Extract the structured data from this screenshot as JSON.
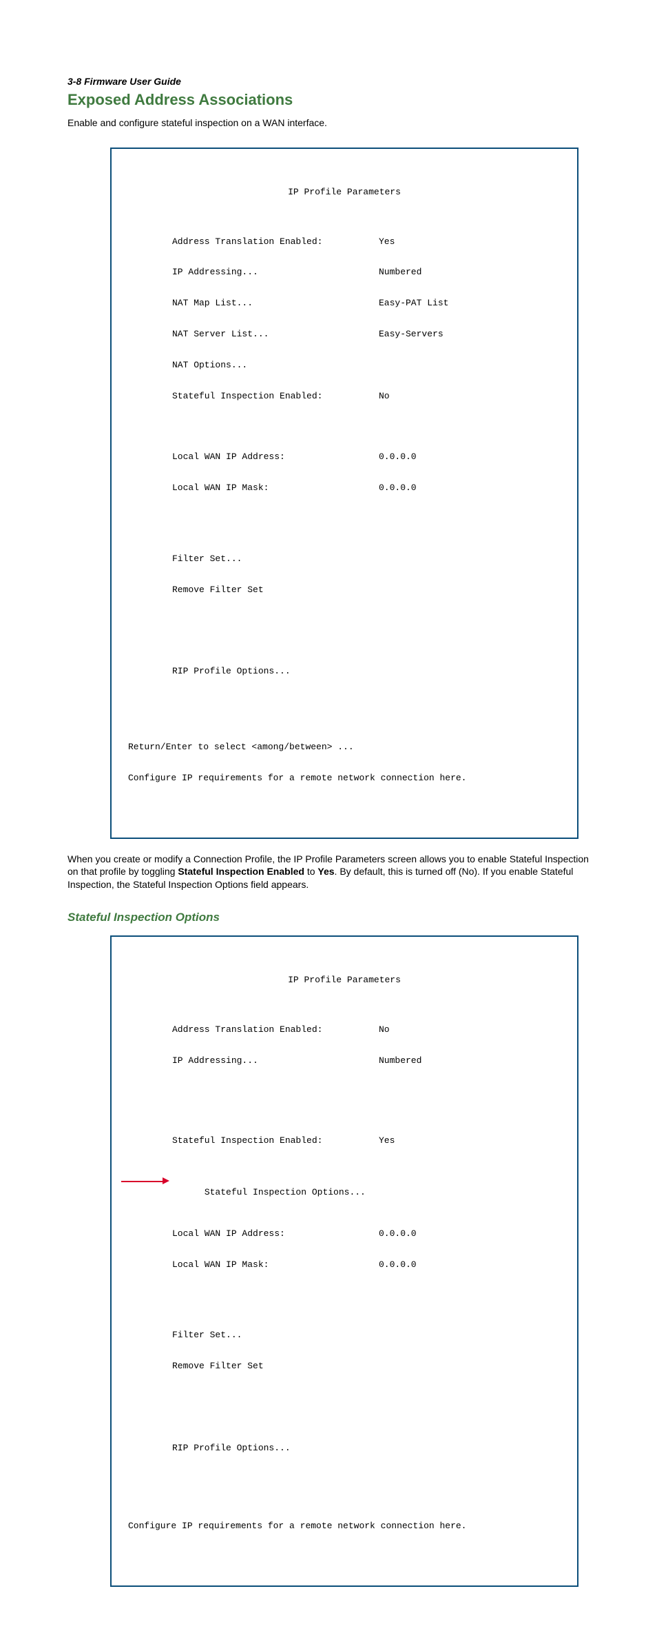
{
  "header": {
    "section": "3-8",
    "guide": " Firmware User Guide"
  },
  "title": "Exposed Address Associations",
  "intro": "Enable and configure stateful inspection on a WAN interface.",
  "box1": {
    "title": "IP Profile Parameters",
    "rows": {
      "ate_label": "Address Translation Enabled:",
      "ate_value": "Yes",
      "ipaddr_label": "IP Addressing...",
      "ipaddr_value": "Numbered",
      "natmap_label": "NAT Map List...",
      "natmap_value": "Easy-PAT List",
      "natsrv_label": "NAT Server List...",
      "natsrv_value": "Easy-Servers",
      "natopt_label": "NAT Options...",
      "sie_label": "Stateful Inspection Enabled:",
      "sie_value": "No",
      "lwip_label": "Local WAN IP Address:",
      "lwip_value": "0.0.0.0",
      "lwmask_label": "Local WAN IP Mask:",
      "lwmask_value": "0.0.0.0",
      "filter_label": "Filter Set...",
      "rmfilter_label": "Remove Filter Set",
      "rip_label": "RIP Profile Options..."
    },
    "footer1": "Return/Enter to select <among/between> ...",
    "footer2": "Configure IP requirements for a remote network connection here."
  },
  "paragraph": {
    "pre": "When you create or modify a Connection Profile, the IP Profile Parameters screen allows you to enable Stateful Inspection on that profile by toggling ",
    "bold1": "Stateful Inspection Enabled",
    "mid": " to ",
    "bold2": "Yes",
    "post": ". By default, this is turned off (No). If you enable Stateful Inspection, the Stateful Inspection Options field appears."
  },
  "subhead": "Stateful Inspection Options",
  "box2": {
    "title": "IP Profile Parameters",
    "rows": {
      "ate_label": "Address Translation Enabled:",
      "ate_value": "No",
      "ipaddr_label": "IP Addressing...",
      "ipaddr_value": "Numbered",
      "sie_label": "Stateful Inspection Enabled:",
      "sie_value": "Yes",
      "sio_label": "Stateful Inspection Options...",
      "lwip_label": "Local WAN IP Address:",
      "lwip_value": "0.0.0.0",
      "lwmask_label": "Local WAN IP Mask:",
      "lwmask_value": "0.0.0.0",
      "filter_label": "Filter Set...",
      "rmfilter_label": "Remove Filter Set",
      "rip_label": "RIP Profile Options..."
    },
    "footer": "Configure IP requirements for a remote network connection here."
  }
}
